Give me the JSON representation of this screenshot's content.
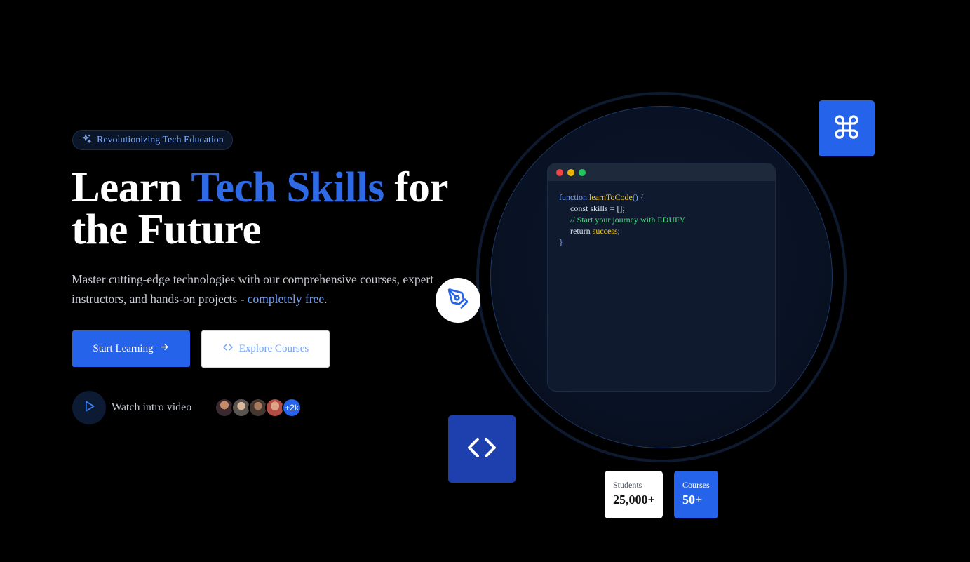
{
  "hero": {
    "badge_text": "Revolutionizing Tech Education",
    "headline_part1": "Learn ",
    "headline_accent": "Tech Skills",
    "headline_part2": " for the Future",
    "subtext_main": "Master cutting-edge technologies with our comprehensive courses, expert instructors, and hands-on projects - ",
    "subtext_highlight": "completely free",
    "subtext_end": ".",
    "primary_button_label": "Start Learning",
    "secondary_button_label": "Explore Courses",
    "watch_label": "Watch intro video",
    "avatars_more_label": "+2k"
  },
  "code_window": {
    "line1_kw": "function ",
    "line1_fn": "learnToCode",
    "line1_rest": "() {",
    "line2": "const skills = [];",
    "line3": "// Start your journey with EDUFY",
    "line4_kw": "return ",
    "line4_val": "success",
    "line4_end": ";",
    "line5": "}"
  },
  "stats": {
    "students_label": "Students",
    "students_value": "25,000+",
    "courses_label": "Courses",
    "courses_value": "50+"
  },
  "icons": {
    "badge": "sparkles-icon",
    "primary_button": "arrow-right-icon",
    "secondary_button": "code-brackets-icon",
    "watch": "play-icon",
    "command_tile": "command-icon",
    "pen_circle": "pen-tool-icon",
    "code_tile": "code-brackets-icon"
  },
  "colors": {
    "accent": "#2563eb",
    "accent_text": "#2f6ae6",
    "background": "#000000",
    "code_keyword": "#7ea6f8",
    "code_function": "#facc15",
    "code_comment": "#4ade80"
  }
}
